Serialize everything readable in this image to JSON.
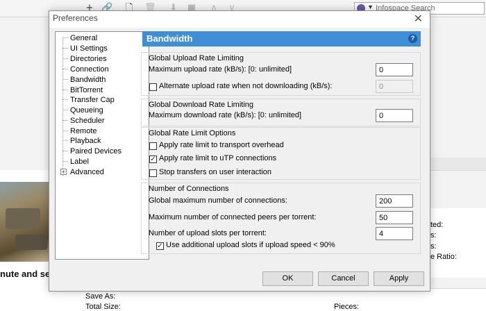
{
  "background": {
    "toolbar": {
      "icons": [
        "add-icon",
        "link-icon",
        "file-icon",
        "delete-icon",
        "download-icon",
        "stop-icon",
        "up-icon",
        "down-icon"
      ]
    },
    "search": {
      "placeholder": "Infospace Search"
    },
    "ad_text": "nute and see v",
    "right_labels": [
      "ted:",
      "s:",
      "s:",
      "e Ratio:"
    ],
    "bottom_labels": [
      "Save As:",
      "Total Size:",
      "Pieces:"
    ]
  },
  "dialog": {
    "title": "Preferences",
    "close_symbol": "✕",
    "tree": {
      "items": [
        {
          "label": "General"
        },
        {
          "label": "UI Settings"
        },
        {
          "label": "Directories"
        },
        {
          "label": "Connection"
        },
        {
          "label": "Bandwidth",
          "selected": true
        },
        {
          "label": "BitTorrent"
        },
        {
          "label": "Transfer Cap"
        },
        {
          "label": "Queueing"
        },
        {
          "label": "Scheduler"
        },
        {
          "label": "Remote"
        },
        {
          "label": "Playback"
        },
        {
          "label": "Paired Devices"
        },
        {
          "label": "Label"
        },
        {
          "label": "Advanced",
          "expander": "+"
        }
      ]
    },
    "panel": {
      "title": "Bandwidth",
      "help_symbol": "?",
      "upload": {
        "title": "Global Upload Rate Limiting",
        "max_label": "Maximum upload rate (kB/s): [0: unlimited]",
        "max_value": "0",
        "alt_label": "Alternate upload rate when not downloading (kB/s):",
        "alt_checked": false,
        "alt_value": "0"
      },
      "download": {
        "title": "Global Download Rate Limiting",
        "max_label": "Maximum download rate (kB/s): [0: unlimited]",
        "max_value": "0"
      },
      "options": {
        "title": "Global Rate Limit Options",
        "transport_label": "Apply rate limit to transport overhead",
        "transport_checked": false,
        "utp_label": "Apply rate limit to uTP connections",
        "utp_checked": true,
        "stop_label": "Stop transfers on user interaction",
        "stop_checked": false
      },
      "connections": {
        "title": "Number of Connections",
        "global_label": "Global maximum number of connections:",
        "global_value": "200",
        "peers_label": "Maximum number of connected peers per torrent:",
        "peers_value": "50",
        "slots_label": "Number of upload slots per torrent:",
        "slots_value": "4",
        "extra_label": "Use additional upload slots if upload speed < 90%",
        "extra_checked": true
      }
    },
    "buttons": {
      "ok": "OK",
      "cancel": "Cancel",
      "apply": "Apply"
    }
  }
}
